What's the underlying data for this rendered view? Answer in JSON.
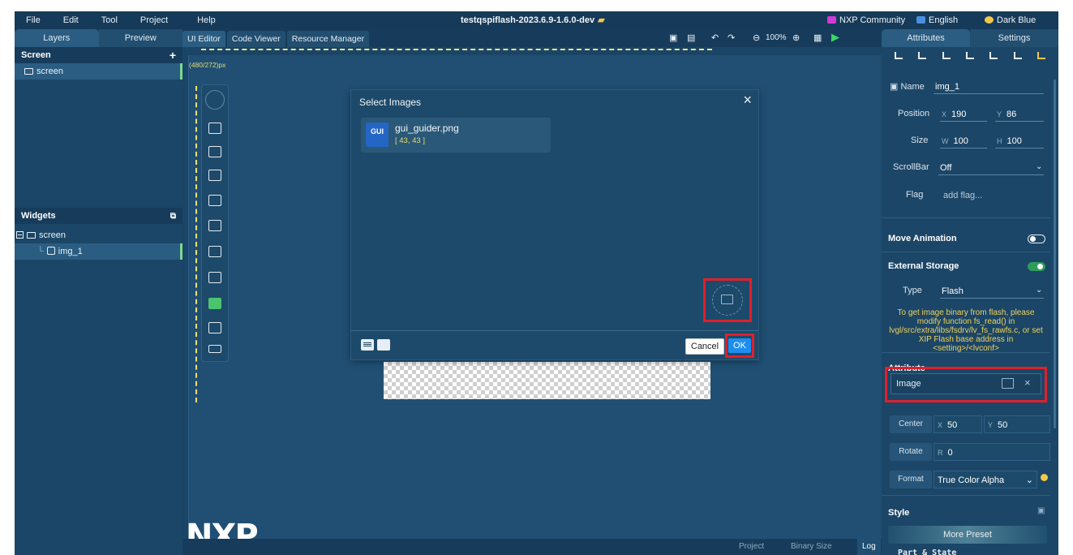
{
  "app": {
    "title": "testqspiflash-2023.6.9-1.6.0-dev",
    "community": "NXP Community",
    "language": "English",
    "theme": "Dark Blue",
    "menu": [
      "File",
      "Edit",
      "Tool",
      "Project",
      "Help"
    ]
  },
  "left_panel": {
    "tabs": [
      "Layers",
      "Preview"
    ],
    "screen_section": {
      "title": "Screen",
      "add_label": "+",
      "items": [
        "screen"
      ]
    },
    "widgets_section": {
      "title": "Widgets",
      "tree": {
        "root": "screen",
        "child": "img_1"
      }
    }
  },
  "center": {
    "tabs": [
      "UI Editor",
      "Code Viewer",
      "Resource Manager"
    ],
    "zoom": "100%",
    "canvas_dim": "(480/272)px",
    "logo": "NXP",
    "bottom_bar": {
      "project": "Project",
      "binary_size": "Binary Size",
      "log": "Log"
    }
  },
  "dialog": {
    "title": "Select Images",
    "close": "×",
    "image": {
      "name": "gui_guider.png",
      "dims": "[ 43, 43 ]",
      "thumb_label": "GUI"
    },
    "cancel": "Cancel",
    "ok": "OK"
  },
  "right_panel": {
    "tabs": [
      "Attributes",
      "Settings"
    ],
    "name": {
      "label": "Name",
      "value": "img_1"
    },
    "position": {
      "label": "Position",
      "x_label": "X",
      "x": "190",
      "y_label": "Y",
      "y": "86"
    },
    "size": {
      "label": "Size",
      "w_label": "W",
      "w": "100",
      "h_label": "H",
      "h": "100"
    },
    "scrollbar": {
      "label": "ScrollBar",
      "value": "Off"
    },
    "flag": {
      "label": "Flag",
      "placeholder": "add flag..."
    },
    "move_animation": {
      "title": "Move Animation",
      "state": "off"
    },
    "external_storage": {
      "title": "External Storage",
      "state": "on",
      "type_label": "Type",
      "type_value": "Flash",
      "note": "To get image binary from flash, please modify function fs_read() in lvgl/src/extra/libs/fsdrv/lv_fs_rawfs.c, or set XIP Flash base address in <setting>/<lvconf>"
    },
    "attribute": {
      "title": "Attribute",
      "image_label": "Image",
      "clear": "×",
      "center": {
        "label": "Center",
        "x_label": "X",
        "x": "50",
        "y_label": "Y",
        "y": "50"
      },
      "rotate": {
        "label": "Rotate",
        "r_label": "R",
        "r": "0"
      },
      "format": {
        "label": "Format",
        "value": "True Color Alpha"
      }
    },
    "style": {
      "title": "Style",
      "more_preset": "More Preset",
      "part_state": "Part & State"
    }
  },
  "colors": {
    "accent_red": "#e0202a",
    "primary_blue": "#1c8ef0",
    "highlight_yellow": "#e6dd6b"
  }
}
